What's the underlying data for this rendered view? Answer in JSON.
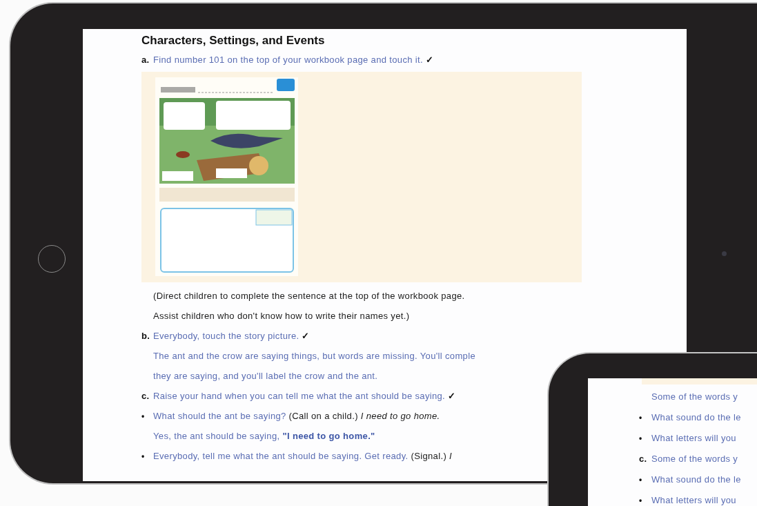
{
  "heading": "Characters, Settings, and Events",
  "content": [
    {
      "kind": "line",
      "marker": "a.",
      "segments": [
        {
          "kind": "prompt",
          "text": "Find number 101 on the top of your workbook page and touch it. "
        },
        {
          "kind": "check",
          "text": "✓"
        }
      ]
    },
    {
      "kind": "image"
    },
    {
      "kind": "line",
      "segments": [
        {
          "kind": "direction",
          "text": "(Direct children to complete the sentence at the top of the workbook page."
        }
      ]
    },
    {
      "kind": "line",
      "segments": [
        {
          "kind": "direction",
          "text": "Assist children who don't know how to write their names yet.)"
        }
      ]
    },
    {
      "kind": "line",
      "marker": "b.",
      "segments": [
        {
          "kind": "prompt",
          "text": "Everybody, touch the story picture. "
        },
        {
          "kind": "check",
          "text": "✓"
        }
      ]
    },
    {
      "kind": "line",
      "segments": [
        {
          "kind": "prompt",
          "text": "The ant and the crow are saying things, but words are missing. You'll comple"
        }
      ]
    },
    {
      "kind": "line",
      "segments": [
        {
          "kind": "prompt",
          "text": "they are saying, and you'll label the crow and the ant."
        }
      ]
    },
    {
      "kind": "line",
      "marker": "c.",
      "segments": [
        {
          "kind": "prompt",
          "text": "Raise your hand when you can tell me what the ant should be saying. "
        },
        {
          "kind": "check",
          "text": "✓"
        }
      ]
    },
    {
      "kind": "line",
      "marker": "•",
      "segments": [
        {
          "kind": "prompt",
          "text": "What should the ant be saying? "
        },
        {
          "kind": "direction",
          "text": "(Call on a child.) "
        },
        {
          "kind": "response",
          "text": "I need to go home."
        }
      ]
    },
    {
      "kind": "line",
      "segments": [
        {
          "kind": "prompt",
          "text": "Yes, the ant should be saying, "
        },
        {
          "kind": "emphasis",
          "text": "\"I need to go home.\""
        }
      ]
    },
    {
      "kind": "line",
      "marker": "•",
      "segments": [
        {
          "kind": "prompt",
          "text": "Everybody, tell me what the ant should be saying. Get ready. "
        },
        {
          "kind": "direction",
          "text": "(Signal.) "
        },
        {
          "kind": "response",
          "text": "I"
        }
      ]
    }
  ],
  "second_device": {
    "lines": [
      {
        "text": "Some of the words y"
      },
      {
        "marker": "•",
        "text": "What sound do the le"
      },
      {
        "marker": "•",
        "text": "What letters will you"
      },
      {
        "marker": "c.",
        "text": "Some of the words y"
      },
      {
        "marker": "•",
        "text": "What sound do the le"
      },
      {
        "marker": "•",
        "text": "What letters will you"
      }
    ]
  }
}
